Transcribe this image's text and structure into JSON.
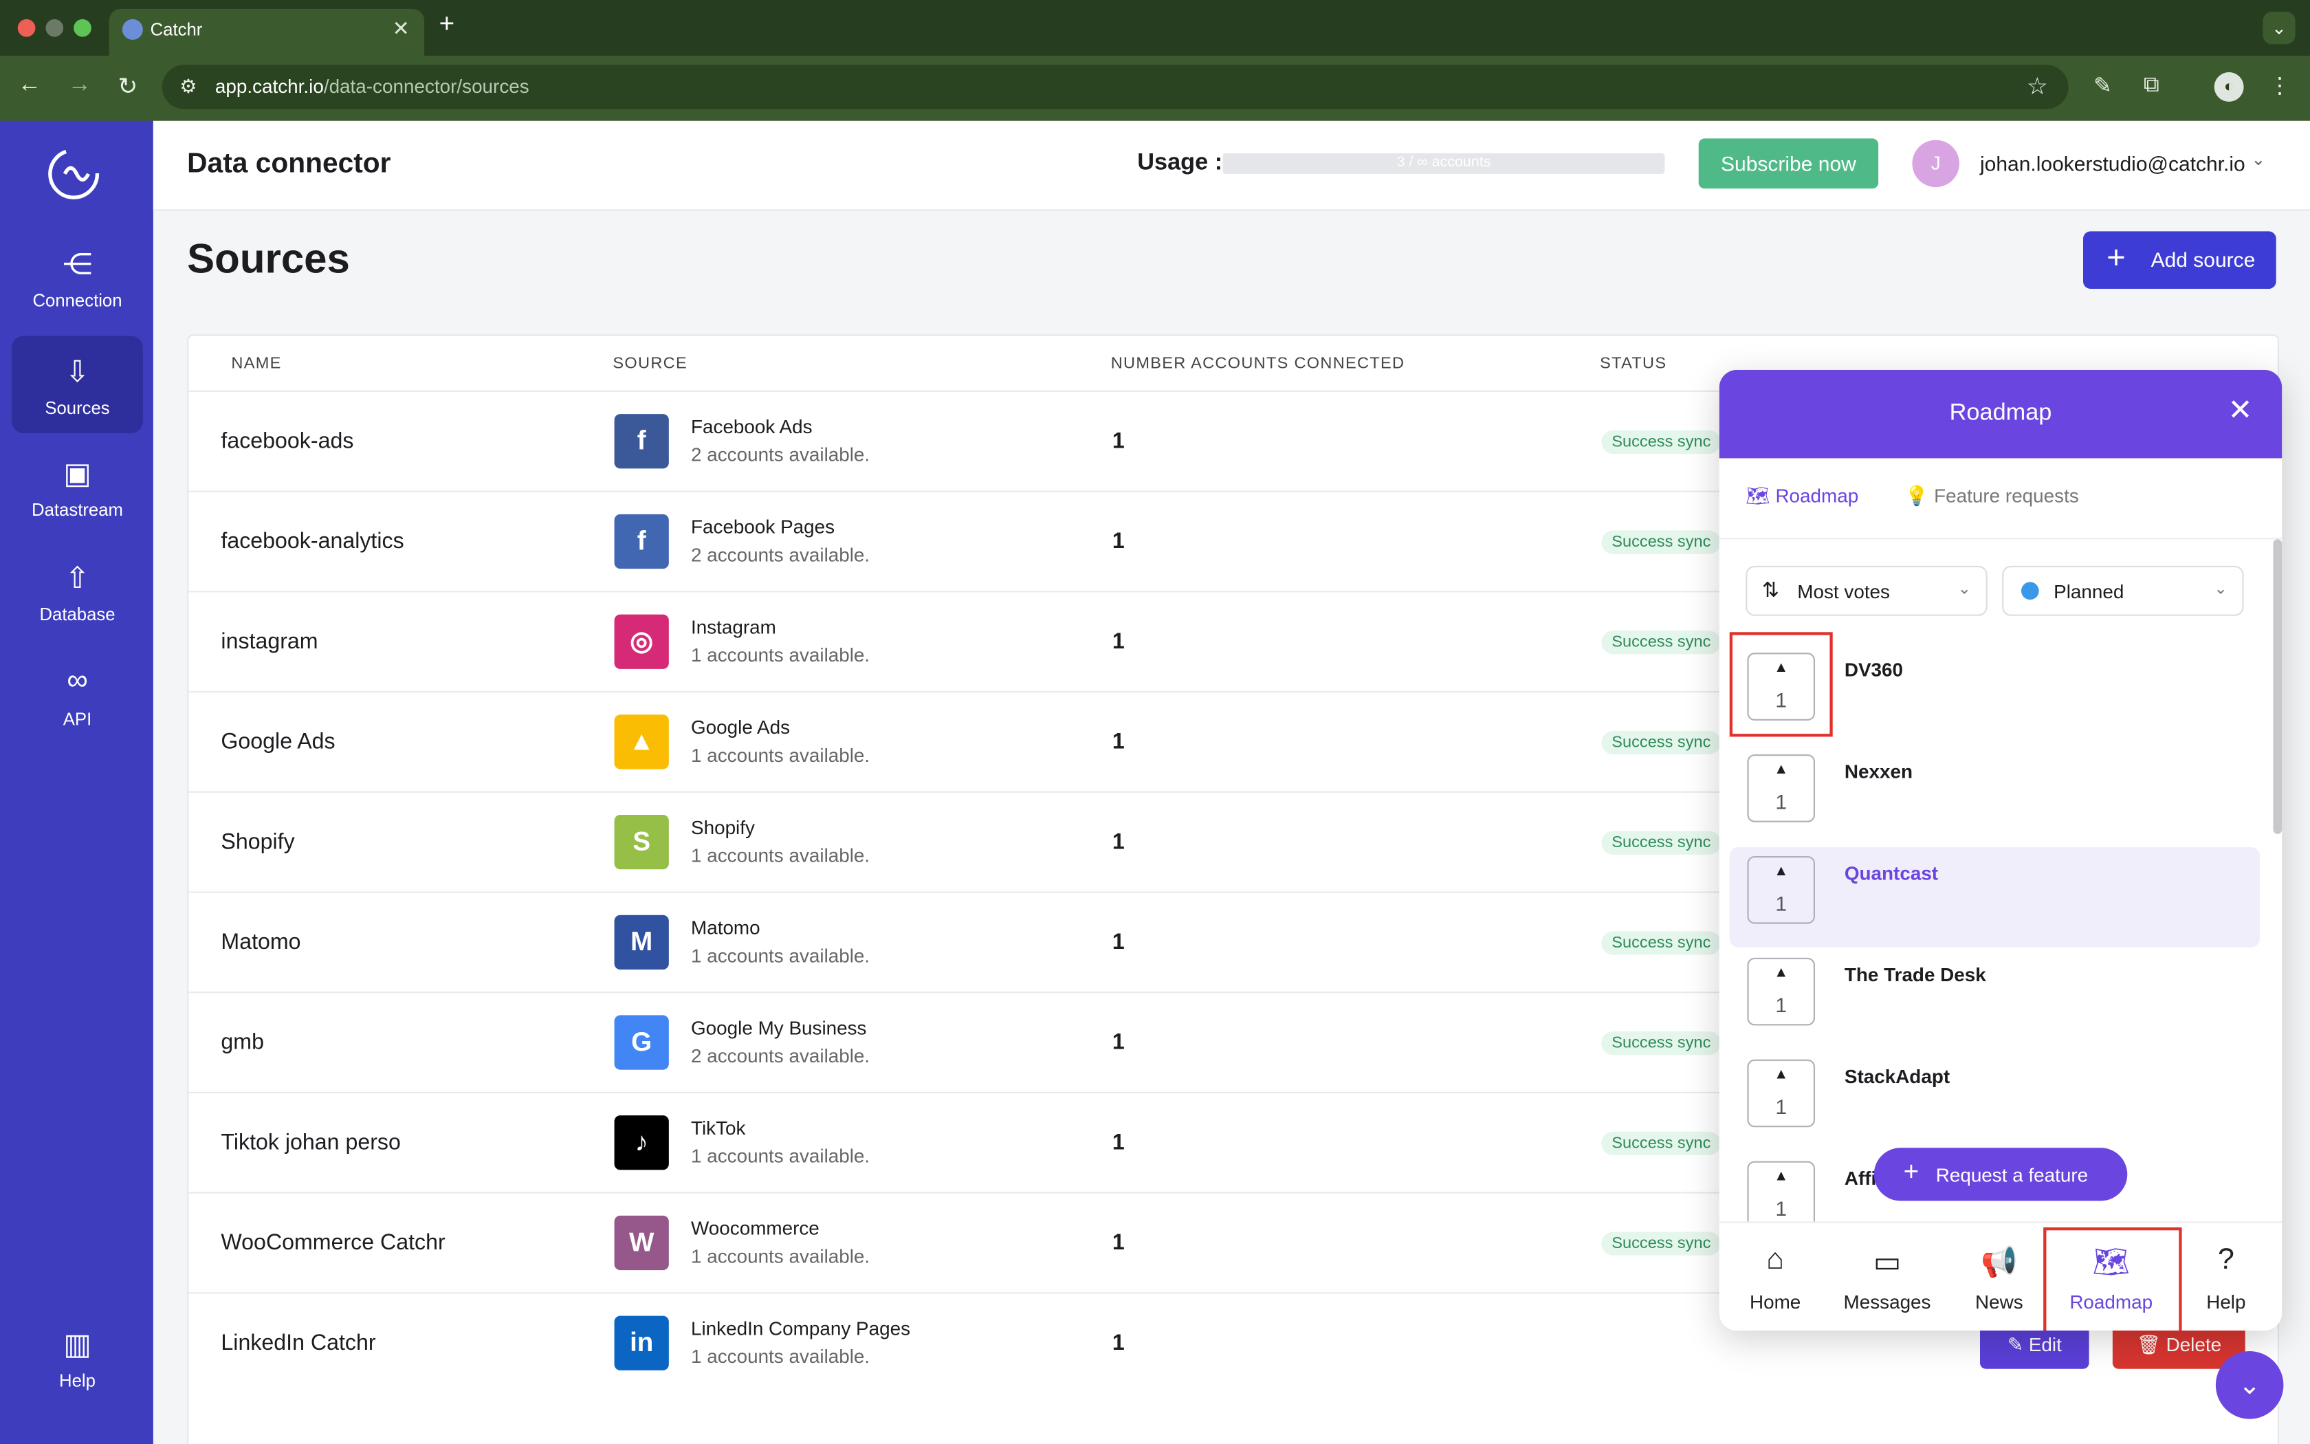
{
  "browser": {
    "tab_title": "Catchr",
    "url_host": "app.catchr.io",
    "url_path": "/data-connector/sources"
  },
  "sidebar": {
    "items": [
      {
        "label": "Connection",
        "icon": "share-icon"
      },
      {
        "label": "Sources",
        "icon": "cloud-download-icon"
      },
      {
        "label": "Datastream",
        "icon": "chip-icon"
      },
      {
        "label": "Database",
        "icon": "cloud-upload-icon"
      },
      {
        "label": "API",
        "icon": "link-icon"
      },
      {
        "label": "Help",
        "icon": "book-icon"
      }
    ]
  },
  "header": {
    "title": "Data connector",
    "usage_label": "Usage :",
    "usage_value": "3 / ∞ accounts",
    "subscribe": "Subscribe now",
    "avatar_initial": "J",
    "email": "johan.lookerstudio@catchr.io"
  },
  "page": {
    "title": "Sources",
    "add_source": "Add source"
  },
  "table": {
    "headers": [
      "NAME",
      "SOURCE",
      "NUMBER ACCOUNTS CONNECTED",
      "STATUS"
    ],
    "rows": [
      {
        "name": "facebook-ads",
        "source": "Facebook Ads",
        "available": "2 accounts available.",
        "count": "1",
        "status": "Success sync",
        "logo_color": "#3b5998"
      },
      {
        "name": "facebook-analytics",
        "source": "Facebook Pages",
        "available": "2 accounts available.",
        "count": "1",
        "status": "Success sync",
        "logo_color": "#4267b2"
      },
      {
        "name": "instagram",
        "source": "Instagram",
        "available": "1 accounts available.",
        "count": "1",
        "status": "Success sync",
        "logo_color": "#d62976"
      },
      {
        "name": "Google Ads",
        "source": "Google Ads",
        "available": "1 accounts available.",
        "count": "1",
        "status": "Success sync",
        "logo_color": "#fbbc04"
      },
      {
        "name": "Shopify",
        "source": "Shopify",
        "available": "1 accounts available.",
        "count": "1",
        "status": "Success sync",
        "logo_color": "#95bf47"
      },
      {
        "name": "Matomo",
        "source": "Matomo",
        "available": "1 accounts available.",
        "count": "1",
        "status": "Success sync",
        "logo_color": "#3152a0"
      },
      {
        "name": "gmb",
        "source": "Google My Business",
        "available": "2 accounts available.",
        "count": "1",
        "status": "Success sync",
        "logo_color": "#4285f4"
      },
      {
        "name": "Tiktok johan perso",
        "source": "TikTok",
        "available": "1 accounts available.",
        "count": "1",
        "status": "Success sync",
        "logo_color": "#000000"
      },
      {
        "name": "WooCommerce Catchr",
        "source": "Woocommerce",
        "available": "1 accounts available.",
        "count": "1",
        "status": "Success sync",
        "logo_color": "#96588a"
      },
      {
        "name": "LinkedIn Catchr",
        "source": "LinkedIn Company Pages",
        "available": "1 accounts available.",
        "count": "1",
        "status": "",
        "logo_color": "#0a66c2"
      }
    ],
    "edit": "Edit",
    "delete": "Delete"
  },
  "roadmap": {
    "title": "Roadmap",
    "tabs": [
      "Roadmap",
      "Feature requests"
    ],
    "sort": "Most votes",
    "filter": "Planned",
    "items": [
      {
        "title": "DV360",
        "votes": "1"
      },
      {
        "title": "Nexxen",
        "votes": "1"
      },
      {
        "title": "Quantcast",
        "votes": "1"
      },
      {
        "title": "The Trade Desk",
        "votes": "1"
      },
      {
        "title": "StackAdapt",
        "votes": "1"
      },
      {
        "title": "Affi",
        "votes": "1"
      }
    ],
    "request": "Request a feature",
    "footer": [
      {
        "label": "Home",
        "icon": "home-icon"
      },
      {
        "label": "Messages",
        "icon": "chat-icon"
      },
      {
        "label": "News",
        "icon": "megaphone-icon"
      },
      {
        "label": "Roadmap",
        "icon": "map-icon"
      },
      {
        "label": "Help",
        "icon": "help-icon"
      }
    ]
  }
}
